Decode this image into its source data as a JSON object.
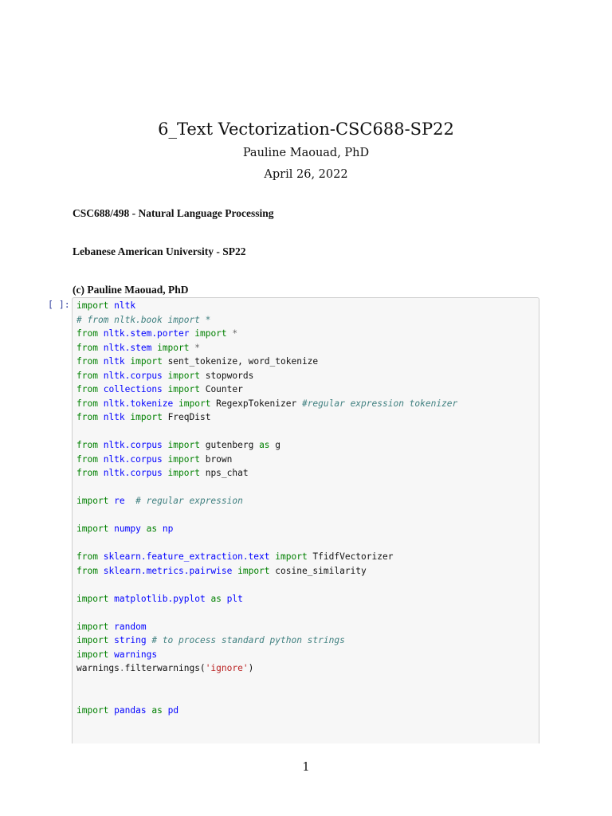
{
  "header": {
    "title": "6_Text Vectorization-CSC688-SP22",
    "author": "Pauline Maouad, PhD",
    "date": "April 26, 2022"
  },
  "headings": [
    "CSC688/498 - Natural Language Processing",
    "Lebanese American University - SP22",
    "(c) Pauline Maouad, PhD"
  ],
  "cell": {
    "prompt": "[ ]:",
    "lines": [
      [
        [
          "kw",
          "import"
        ],
        [
          "t",
          " "
        ],
        [
          "nn",
          "nltk"
        ]
      ],
      [
        [
          "c",
          "# from nltk.book import *"
        ]
      ],
      [
        [
          "kw",
          "from"
        ],
        [
          "t",
          " "
        ],
        [
          "nn",
          "nltk.stem.porter"
        ],
        [
          "t",
          " "
        ],
        [
          "kw",
          "import"
        ],
        [
          "t",
          " "
        ],
        [
          "o",
          "*"
        ]
      ],
      [
        [
          "kw",
          "from"
        ],
        [
          "t",
          " "
        ],
        [
          "nn",
          "nltk.stem"
        ],
        [
          "t",
          " "
        ],
        [
          "kw",
          "import"
        ],
        [
          "t",
          " "
        ],
        [
          "o",
          "*"
        ]
      ],
      [
        [
          "kw",
          "from"
        ],
        [
          "t",
          " "
        ],
        [
          "nn",
          "nltk"
        ],
        [
          "t",
          " "
        ],
        [
          "kw",
          "import"
        ],
        [
          "t",
          " sent_tokenize, word_tokenize"
        ]
      ],
      [
        [
          "kw",
          "from"
        ],
        [
          "t",
          " "
        ],
        [
          "nn",
          "nltk.corpus"
        ],
        [
          "t",
          " "
        ],
        [
          "kw",
          "import"
        ],
        [
          "t",
          " stopwords"
        ]
      ],
      [
        [
          "kw",
          "from"
        ],
        [
          "t",
          " "
        ],
        [
          "nn",
          "collections"
        ],
        [
          "t",
          " "
        ],
        [
          "kw",
          "import"
        ],
        [
          "t",
          " Counter"
        ]
      ],
      [
        [
          "kw",
          "from"
        ],
        [
          "t",
          " "
        ],
        [
          "nn",
          "nltk.tokenize"
        ],
        [
          "t",
          " "
        ],
        [
          "kw",
          "import"
        ],
        [
          "t",
          " RegexpTokenizer "
        ],
        [
          "c",
          "#regular expression tokenizer"
        ]
      ],
      [
        [
          "kw",
          "from"
        ],
        [
          "t",
          " "
        ],
        [
          "nn",
          "nltk"
        ],
        [
          "t",
          " "
        ],
        [
          "kw",
          "import"
        ],
        [
          "t",
          " FreqDist"
        ]
      ],
      [],
      [
        [
          "kw",
          "from"
        ],
        [
          "t",
          " "
        ],
        [
          "nn",
          "nltk.corpus"
        ],
        [
          "t",
          " "
        ],
        [
          "kw",
          "import"
        ],
        [
          "t",
          " gutenberg "
        ],
        [
          "kw",
          "as"
        ],
        [
          "t",
          " g"
        ]
      ],
      [
        [
          "kw",
          "from"
        ],
        [
          "t",
          " "
        ],
        [
          "nn",
          "nltk.corpus"
        ],
        [
          "t",
          " "
        ],
        [
          "kw",
          "import"
        ],
        [
          "t",
          " brown"
        ]
      ],
      [
        [
          "kw",
          "from"
        ],
        [
          "t",
          " "
        ],
        [
          "nn",
          "nltk.corpus"
        ],
        [
          "t",
          " "
        ],
        [
          "kw",
          "import"
        ],
        [
          "t",
          " nps_chat"
        ]
      ],
      [],
      [
        [
          "kw",
          "import"
        ],
        [
          "t",
          " "
        ],
        [
          "nn",
          "re"
        ],
        [
          "t",
          "  "
        ],
        [
          "c",
          "# regular expression"
        ]
      ],
      [],
      [
        [
          "kw",
          "import"
        ],
        [
          "t",
          " "
        ],
        [
          "nn",
          "numpy"
        ],
        [
          "t",
          " "
        ],
        [
          "kw",
          "as"
        ],
        [
          "t",
          " "
        ],
        [
          "nn",
          "np"
        ]
      ],
      [],
      [
        [
          "kw",
          "from"
        ],
        [
          "t",
          " "
        ],
        [
          "nn",
          "sklearn.feature_extraction.text"
        ],
        [
          "t",
          " "
        ],
        [
          "kw",
          "import"
        ],
        [
          "t",
          " TfidfVectorizer"
        ]
      ],
      [
        [
          "kw",
          "from"
        ],
        [
          "t",
          " "
        ],
        [
          "nn",
          "sklearn.metrics.pairwise"
        ],
        [
          "t",
          " "
        ],
        [
          "kw",
          "import"
        ],
        [
          "t",
          " cosine_similarity"
        ]
      ],
      [],
      [
        [
          "kw",
          "import"
        ],
        [
          "t",
          " "
        ],
        [
          "nn",
          "matplotlib.pyplot"
        ],
        [
          "t",
          " "
        ],
        [
          "kw",
          "as"
        ],
        [
          "t",
          " "
        ],
        [
          "nn",
          "plt"
        ]
      ],
      [],
      [
        [
          "kw",
          "import"
        ],
        [
          "t",
          " "
        ],
        [
          "nn",
          "random"
        ]
      ],
      [
        [
          "kw",
          "import"
        ],
        [
          "t",
          " "
        ],
        [
          "nn",
          "string"
        ],
        [
          "t",
          " "
        ],
        [
          "c",
          "# to process standard python strings"
        ]
      ],
      [
        [
          "kw",
          "import"
        ],
        [
          "t",
          " "
        ],
        [
          "nn",
          "warnings"
        ]
      ],
      [
        [
          "t",
          "warnings"
        ],
        [
          "o",
          "."
        ],
        [
          "t",
          "filterwarnings("
        ],
        [
          "s",
          "'ignore'"
        ],
        [
          "t",
          ")"
        ]
      ],
      [],
      [],
      [
        [
          "kw",
          "import"
        ],
        [
          "t",
          " "
        ],
        [
          "nn",
          "pandas"
        ],
        [
          "t",
          " "
        ],
        [
          "kw",
          "as"
        ],
        [
          "t",
          " "
        ],
        [
          "nn",
          "pd"
        ]
      ]
    ]
  },
  "footer": {
    "page_number": "1"
  }
}
